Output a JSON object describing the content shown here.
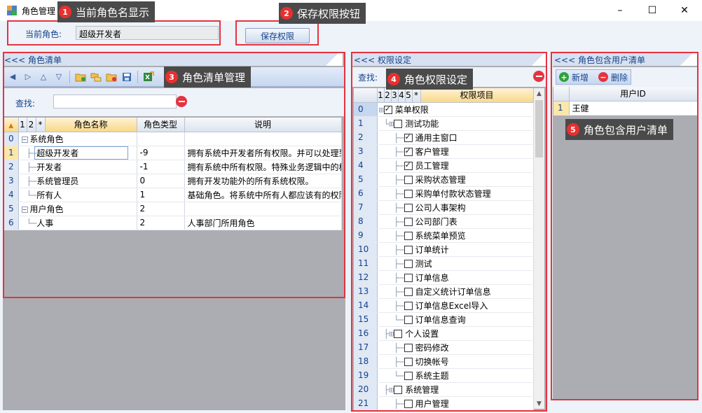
{
  "window": {
    "title": "角色管理",
    "min_glyph": "–",
    "max_glyph": "☐",
    "close_glyph": "✕"
  },
  "current_role": {
    "label": "当前角色:",
    "value": "超级开发者"
  },
  "save_button": "保存权限",
  "callouts": [
    {
      "num": "1",
      "text": "当前角色名显示"
    },
    {
      "num": "2",
      "text": "保存权限按钮"
    },
    {
      "num": "3",
      "text": "角色清单管理"
    },
    {
      "num": "4",
      "text": "角色权限设定"
    },
    {
      "num": "5",
      "text": "角色包含用户清单"
    }
  ],
  "role_panel": {
    "header": "<<< 角色清单",
    "search_label": "查找:",
    "columns": {
      "c1": "1",
      "c2": "2",
      "c3": "*",
      "name": "角色名称",
      "type": "角色类型",
      "desc": "说明"
    },
    "rows": [
      {
        "num": "0",
        "name": "系统角色",
        "type": "",
        "desc": ""
      },
      {
        "num": "1",
        "name": "超级开发者",
        "type": "-9",
        "desc": "拥有系统中开发者所有权限。并可以处理到"
      },
      {
        "num": "2",
        "name": "开发者",
        "type": "-1",
        "desc": "拥有系统中所有权限。特殊业务逻辑中的权"
      },
      {
        "num": "3",
        "name": "系统管理员",
        "type": "0",
        "desc": "拥有开发功能外的所有系统权限。"
      },
      {
        "num": "4",
        "name": "所有人",
        "type": "1",
        "desc": "基础角色。将系统中所有人都应该有的权限"
      },
      {
        "num": "5",
        "name": "用户角色",
        "type": "2",
        "desc": ""
      },
      {
        "num": "6",
        "name": "人事",
        "type": "2",
        "desc": "人事部门所用角色"
      }
    ]
  },
  "perm_panel": {
    "header": "<<< 权限设定",
    "search_label": "查找:",
    "columns": {
      "c1": "1",
      "c2": "2",
      "c3": "3",
      "c4": "4",
      "c5": "5",
      "c6": "*",
      "item": "权限项目"
    },
    "rows": [
      {
        "num": "0",
        "label": "菜单权限",
        "checked": true
      },
      {
        "num": "1",
        "label": "测试功能",
        "checked": false
      },
      {
        "num": "2",
        "label": "通用主窗口",
        "checked": true
      },
      {
        "num": "3",
        "label": "客户管理",
        "checked": true
      },
      {
        "num": "4",
        "label": "员工管理",
        "checked": true
      },
      {
        "num": "5",
        "label": "采购状态管理",
        "checked": false
      },
      {
        "num": "6",
        "label": "采购单付款状态管理",
        "checked": false
      },
      {
        "num": "7",
        "label": "公司人事架构",
        "checked": false
      },
      {
        "num": "8",
        "label": "公司部门表",
        "checked": false
      },
      {
        "num": "9",
        "label": "系统菜单预览",
        "checked": false
      },
      {
        "num": "10",
        "label": "订单统计",
        "checked": false
      },
      {
        "num": "11",
        "label": "测试",
        "checked": false
      },
      {
        "num": "12",
        "label": "订单信息",
        "checked": false
      },
      {
        "num": "13",
        "label": "自定义统计订单信息",
        "checked": false
      },
      {
        "num": "14",
        "label": "订单信息Excel导入",
        "checked": false
      },
      {
        "num": "15",
        "label": "订单信息查询",
        "checked": false
      },
      {
        "num": "16",
        "label": "个人设置",
        "checked": false
      },
      {
        "num": "17",
        "label": "密码修改",
        "checked": false
      },
      {
        "num": "18",
        "label": "切换帐号",
        "checked": false
      },
      {
        "num": "19",
        "label": "系统主题",
        "checked": false
      },
      {
        "num": "20",
        "label": "系统管理",
        "checked": false
      },
      {
        "num": "21",
        "label": "用户管理",
        "checked": false
      }
    ]
  },
  "user_panel": {
    "header": "<<< 角色包含用户清单",
    "add_label": "新增",
    "delete_label": "删除",
    "columns": {
      "userid": "用户ID"
    },
    "rows": [
      {
        "num": "1",
        "userid": "王健"
      }
    ]
  }
}
